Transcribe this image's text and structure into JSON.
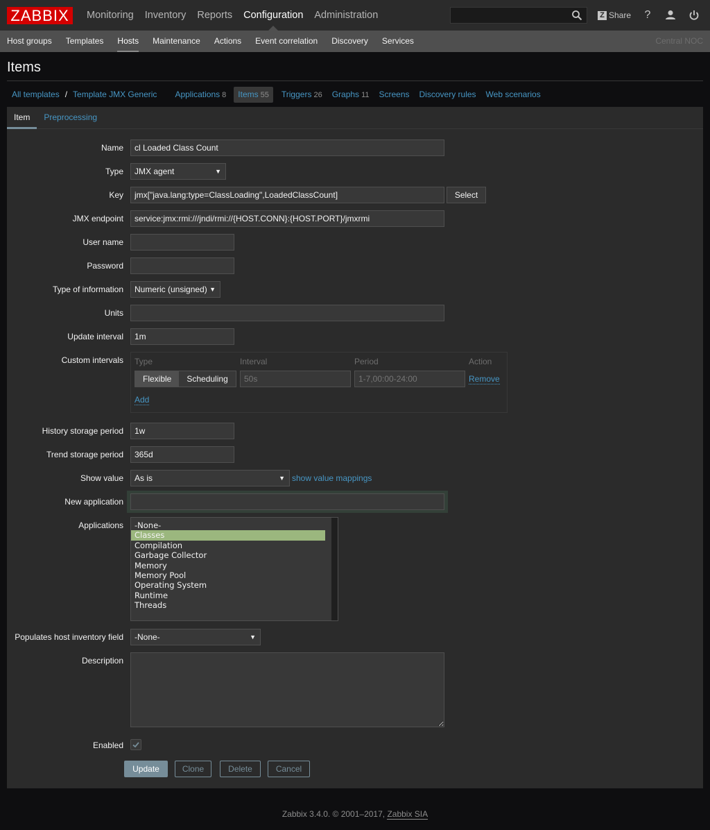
{
  "header": {
    "logo": "ZABBIX",
    "main_menu": [
      {
        "label": "Monitoring",
        "selected": false
      },
      {
        "label": "Inventory",
        "selected": false
      },
      {
        "label": "Reports",
        "selected": false
      },
      {
        "label": "Configuration",
        "selected": true
      },
      {
        "label": "Administration",
        "selected": false
      }
    ],
    "search": {
      "value": "",
      "placeholder": ""
    },
    "share_label": "Share",
    "share_badge": "Z",
    "help_icon": "?",
    "icons": [
      "search-icon",
      "share-icon",
      "help-icon",
      "user-profile-icon",
      "sign-out-icon"
    ]
  },
  "subnav": {
    "items": [
      {
        "label": "Host groups",
        "selected": false
      },
      {
        "label": "Templates",
        "selected": false
      },
      {
        "label": "Hosts",
        "selected": true
      },
      {
        "label": "Maintenance",
        "selected": false
      },
      {
        "label": "Actions",
        "selected": false
      },
      {
        "label": "Event correlation",
        "selected": false
      },
      {
        "label": "Discovery",
        "selected": false
      },
      {
        "label": "Services",
        "selected": false
      }
    ],
    "server_name": "Central NOC"
  },
  "page": {
    "title": "Items"
  },
  "breadcrumbs": {
    "all_templates": "All templates",
    "separator": "/",
    "template": "Template JMX Generic",
    "links": [
      {
        "label": "Applications",
        "count": "8",
        "active": false
      },
      {
        "label": "Items",
        "count": "55",
        "active": true
      },
      {
        "label": "Triggers",
        "count": "26",
        "active": false
      },
      {
        "label": "Graphs",
        "count": "11",
        "active": false
      },
      {
        "label": "Screens",
        "count": "",
        "active": false
      },
      {
        "label": "Discovery rules",
        "count": "",
        "active": false
      },
      {
        "label": "Web scenarios",
        "count": "",
        "active": false
      }
    ]
  },
  "tabs": [
    {
      "label": "Item",
      "active": true
    },
    {
      "label": "Preprocessing",
      "active": false
    }
  ],
  "form": {
    "name": {
      "label": "Name",
      "value": "cl Loaded Class Count"
    },
    "type": {
      "label": "Type",
      "value": "JMX agent"
    },
    "key": {
      "label": "Key",
      "value": "jmx[\"java.lang:type=ClassLoading\",LoadedClassCount]",
      "select_label": "Select"
    },
    "jmx_endpoint": {
      "label": "JMX endpoint",
      "value": "service:jmx:rmi:///jndi/rmi://{HOST.CONN}:{HOST.PORT}/jmxrmi"
    },
    "user_name": {
      "label": "User name",
      "value": ""
    },
    "password": {
      "label": "Password",
      "value": ""
    },
    "type_of_information": {
      "label": "Type of information",
      "value": "Numeric (unsigned)"
    },
    "units": {
      "label": "Units",
      "value": ""
    },
    "update_interval": {
      "label": "Update interval",
      "value": "1m"
    },
    "custom_intervals": {
      "label": "Custom intervals",
      "columns": [
        "Type",
        "Interval",
        "Period",
        "Action"
      ],
      "rows": [
        {
          "type_options": [
            "Flexible",
            "Scheduling"
          ],
          "type_selected": "Flexible",
          "interval_placeholder": "50s",
          "period_placeholder": "1-7,00:00-24:00",
          "action": "Remove"
        }
      ],
      "add_label": "Add"
    },
    "history": {
      "label": "History storage period",
      "value": "1w"
    },
    "trend": {
      "label": "Trend storage period",
      "value": "365d"
    },
    "show_value": {
      "label": "Show value",
      "value": "As is",
      "link": "show value mappings"
    },
    "new_application": {
      "label": "New application",
      "value": ""
    },
    "applications": {
      "label": "Applications",
      "options": [
        "-None-",
        "Classes",
        "Compilation",
        "Garbage Collector",
        "Memory",
        "Memory Pool",
        "Operating System",
        "Runtime",
        "Threads"
      ],
      "selected": "Classes"
    },
    "inventory_field": {
      "label": "Populates host inventory field",
      "value": "-None-"
    },
    "description": {
      "label": "Description",
      "value": ""
    },
    "enabled": {
      "label": "Enabled",
      "checked": true
    },
    "buttons": {
      "update": "Update",
      "clone": "Clone",
      "delete": "Delete",
      "cancel": "Cancel"
    }
  },
  "colors": {
    "brand": "#d40000",
    "link": "#4796c4",
    "primary_button": "#768d99",
    "selected_option": "#9bb77e"
  },
  "footer": {
    "text": "Zabbix 3.4.0. © 2001–2017, ",
    "link": "Zabbix SIA"
  }
}
